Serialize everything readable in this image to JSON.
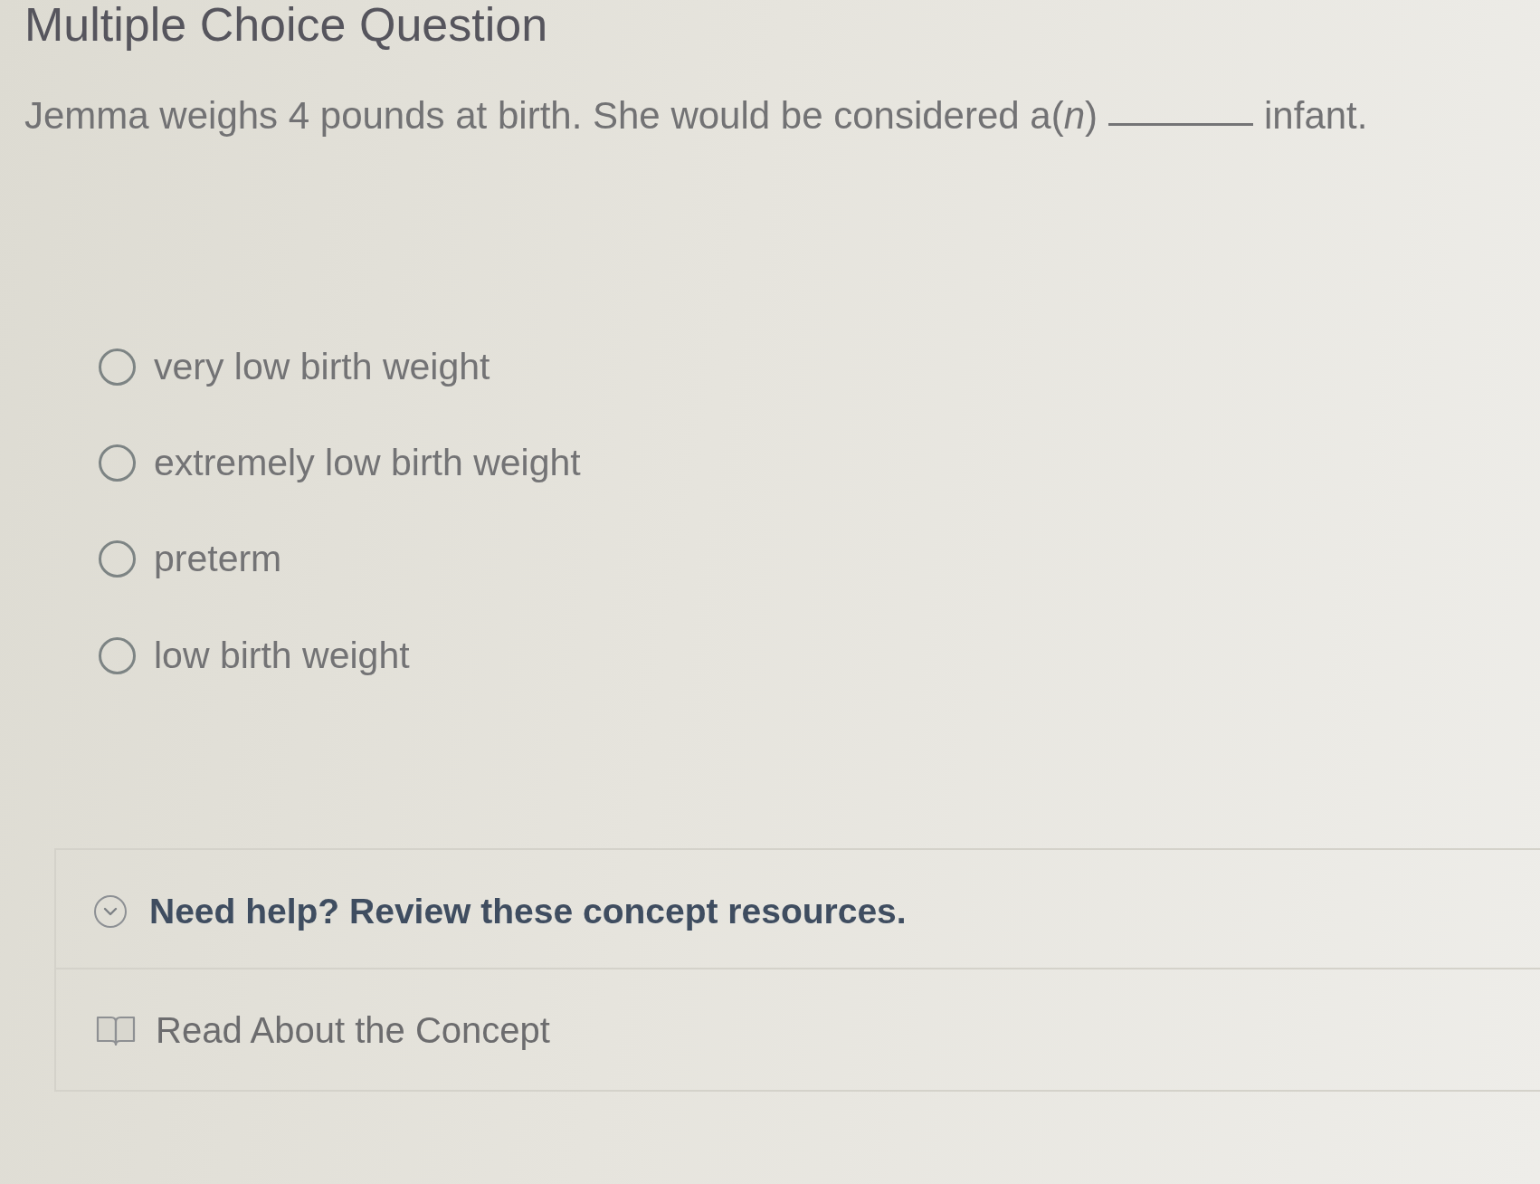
{
  "heading": "Multiple Choice Question",
  "question": {
    "text_before": "Jemma weighs 4 pounds at birth. She would be considered a(*n*)",
    "text_after": "infant."
  },
  "options": [
    {
      "label": "very low birth weight",
      "selected": false
    },
    {
      "label": "extremely low birth weight",
      "selected": false
    },
    {
      "label": "preterm",
      "selected": false
    },
    {
      "label": "low birth weight",
      "selected": false
    }
  ],
  "help": {
    "title": "Need help? Review these concept resources.",
    "expanded": true,
    "resources": [
      {
        "label": "Read About the Concept"
      }
    ]
  }
}
